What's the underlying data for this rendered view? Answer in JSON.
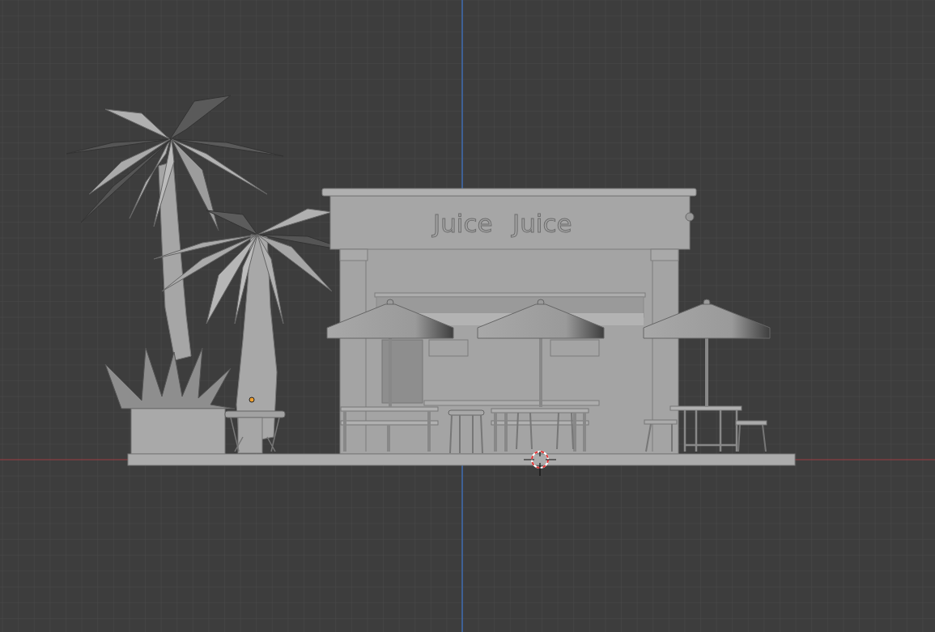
{
  "viewport": {
    "scene": {
      "sign_texts": [
        "Juice",
        "Juice"
      ]
    }
  }
}
